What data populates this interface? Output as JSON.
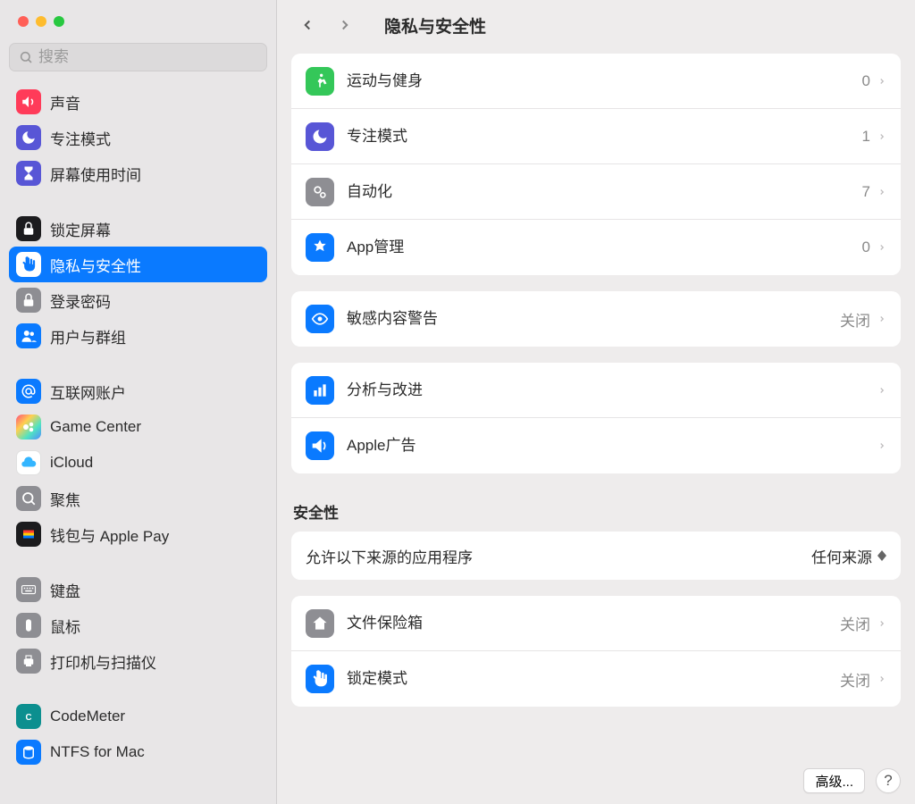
{
  "window": {
    "title": "隐私与安全性"
  },
  "search": {
    "placeholder": "搜索"
  },
  "sidebar": [
    {
      "id": "sound",
      "label": "声音",
      "icon": "volume",
      "bg": "bg-pink"
    },
    {
      "id": "focus-side",
      "label": "专注模式",
      "icon": "moon",
      "bg": "bg-indigo"
    },
    {
      "id": "screentime",
      "label": "屏幕使用时间",
      "icon": "hourglass",
      "bg": "bg-hourglass"
    },
    {
      "gap": true
    },
    {
      "id": "lockscreen",
      "label": "锁定屏幕",
      "icon": "lock",
      "bg": "bg-black"
    },
    {
      "id": "privacy",
      "label": "隐私与安全性",
      "icon": "hand",
      "bg": "bg-blue",
      "selected": true
    },
    {
      "id": "login-pw",
      "label": "登录密码",
      "icon": "lock",
      "bg": "bg-gray"
    },
    {
      "id": "users",
      "label": "用户与群组",
      "icon": "people",
      "bg": "bg-people"
    },
    {
      "gap": true
    },
    {
      "id": "internet",
      "label": "互联网账户",
      "icon": "at",
      "bg": "bg-at"
    },
    {
      "id": "gamecenter",
      "label": "Game Center",
      "icon": "gc",
      "bg": "bg-gc"
    },
    {
      "id": "icloud",
      "label": "iCloud",
      "icon": "cloud",
      "bg": "bg-cloud"
    },
    {
      "id": "spotlight",
      "label": "聚焦",
      "icon": "search",
      "bg": "bg-spot"
    },
    {
      "id": "wallet",
      "label": "钱包与 Apple Pay",
      "icon": "wallet",
      "bg": "bg-wallet"
    },
    {
      "gap": true
    },
    {
      "id": "keyboard",
      "label": "键盘",
      "icon": "keyboard",
      "bg": "bg-kb"
    },
    {
      "id": "mouse",
      "label": "鼠标",
      "icon": "mouse",
      "bg": "bg-mouse"
    },
    {
      "id": "printer",
      "label": "打印机与扫描仪",
      "icon": "printer",
      "bg": "bg-printer"
    },
    {
      "gap": true
    },
    {
      "id": "codemeter",
      "label": "CodeMeter",
      "icon": "cm",
      "bg": "bg-cm"
    },
    {
      "id": "ntfs",
      "label": "NTFS for Mac",
      "icon": "ntfs",
      "bg": "bg-ntfs"
    }
  ],
  "groups": [
    {
      "rows": [
        {
          "id": "fitness",
          "label": "运动与健身",
          "value": "0",
          "icon": "run",
          "bg": "bg-green"
        },
        {
          "id": "focus",
          "label": "专注模式",
          "value": "1",
          "icon": "moon",
          "bg": "bg-focus"
        },
        {
          "id": "automation",
          "label": "自动化",
          "value": "7",
          "icon": "gears",
          "bg": "bg-auto"
        },
        {
          "id": "appmgmt",
          "label": "App管理",
          "value": "0",
          "icon": "app",
          "bg": "bg-app"
        }
      ]
    },
    {
      "rows": [
        {
          "id": "sensitive",
          "label": "敏感内容警告",
          "value": "关闭",
          "icon": "eye",
          "bg": "bg-eye"
        }
      ]
    },
    {
      "rows": [
        {
          "id": "analytics",
          "label": "分析与改进",
          "value": "",
          "icon": "chart",
          "bg": "bg-chart"
        },
        {
          "id": "ads",
          "label": "Apple广告",
          "value": "",
          "icon": "ad",
          "bg": "bg-ad"
        }
      ]
    }
  ],
  "security": {
    "title": "安全性",
    "allow_label": "允许以下来源的应用程序",
    "allow_value": "任何来源",
    "rows": [
      {
        "id": "filevault",
        "label": "文件保险箱",
        "value": "关闭",
        "icon": "house",
        "bg": "bg-vault"
      },
      {
        "id": "lockdown",
        "label": "锁定模式",
        "value": "关闭",
        "icon": "hand",
        "bg": "bg-lock"
      }
    ]
  },
  "footer": {
    "advanced": "高级...",
    "help": "?"
  }
}
